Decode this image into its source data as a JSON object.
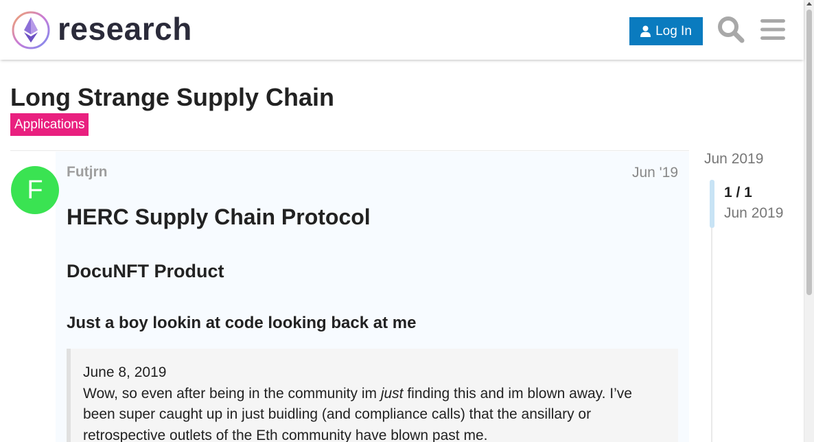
{
  "header": {
    "logo_text": "research",
    "login_label": "Log In"
  },
  "topic": {
    "title": "Long Strange Supply Chain",
    "category": "Applications",
    "category_color": "#e9207f"
  },
  "post": {
    "avatar_letter": "F",
    "avatar_color": "#3ae352",
    "author": "Futjrn",
    "date": "Jun '19",
    "heading_1": "HERC Supply Chain Protocol",
    "heading_2": "DocuNFT Product",
    "heading_3": "Just a boy lookin at code looking back at me",
    "quote": {
      "date_line": "June 8, 2019",
      "text_before": "Wow, so even after being in the community im ",
      "text_italic": "just",
      "text_after": " finding this and im blown away. I’ve been super caught up in just buidling (and compliance calls) that the ansillary or retrospective outlets of the Eth community have blown past me."
    }
  },
  "timeline": {
    "top_date": "Jun 2019",
    "position": "1 / 1",
    "current_date": "Jun 2019"
  },
  "icons": {
    "logo": "ethereum-research-logo",
    "login": "user-icon",
    "search": "search-icon",
    "menu": "hamburger-menu-icon"
  },
  "colors": {
    "accent": "#0a7bbf"
  }
}
